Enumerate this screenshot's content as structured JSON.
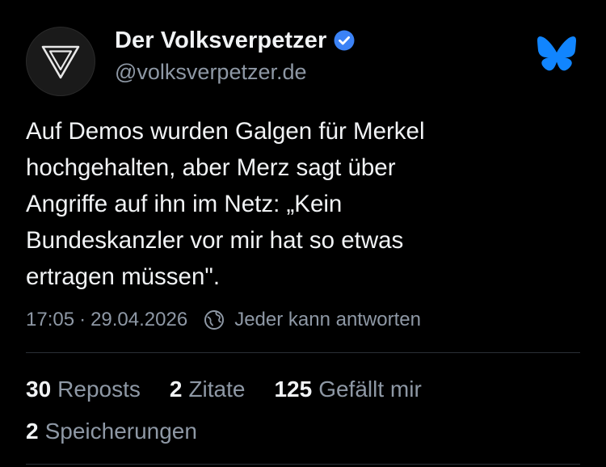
{
  "author": {
    "display_name": "Der Volksverpetzer",
    "handle": "@volksverpetzer.de",
    "avatar_icon": "inverted-triangle-logo-icon",
    "verified_icon": "verified-check-icon",
    "verified_color": "#3b82f6"
  },
  "app": {
    "logo_icon": "bluesky-butterfly-icon",
    "brand_color": "#1185fe"
  },
  "post": {
    "text": "Auf Demos wurden Galgen für Merkel\nhochgehalten, aber Merz sagt über\nAngriffe auf ihn im Netz: „Kein\nBundeskanzler vor mir hat so etwas\nertragen müssen\"."
  },
  "meta": {
    "time": "17:05",
    "separator": "·",
    "date": "29.04.2026",
    "reply_icon": "globe-reply-icon",
    "reply_setting": "Jeder kann antworten"
  },
  "stats": {
    "reposts_count": "30",
    "reposts_label": "Reposts",
    "quotes_count": "2",
    "quotes_label": "Zitate",
    "likes_count": "125",
    "likes_label": "Gefällt mir",
    "saves_count": "2",
    "saves_label": "Speicherungen"
  },
  "colors": {
    "background": "#000000",
    "text_primary": "#f1f3f5",
    "text_secondary": "#8e98a5",
    "divider": "#2a2f36"
  }
}
